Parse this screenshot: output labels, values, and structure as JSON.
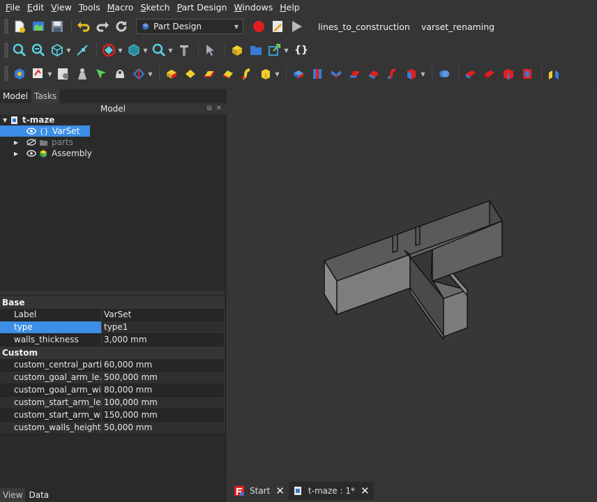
{
  "menu": [
    "File",
    "Edit",
    "View",
    "Tools",
    "Macro",
    "Sketch",
    "Part Design",
    "Windows",
    "Help"
  ],
  "menu_mnemonic": [
    "F",
    "E",
    "V",
    "T",
    "M",
    "S",
    "P",
    "W",
    "H"
  ],
  "workbench": {
    "selected": "Part Design"
  },
  "macros": [
    "lines_to_construction",
    "varset_renaming"
  ],
  "panel": {
    "tabs": [
      "Model",
      "Tasks"
    ],
    "header": "Model",
    "bottom_tabs": [
      "View",
      "Data"
    ]
  },
  "tree": {
    "root": "t-maze",
    "items": [
      {
        "label": "VarSet",
        "selected": true
      },
      {
        "label": "parts",
        "hidden": true
      },
      {
        "label": "Assembly"
      }
    ]
  },
  "properties": {
    "groups": [
      {
        "name": "Base",
        "rows": [
          {
            "name": "Label",
            "value": "VarSet"
          },
          {
            "name": "type",
            "value": "type1",
            "selected": true
          },
          {
            "name": "walls_thickness",
            "value": "3,000 mm"
          }
        ]
      },
      {
        "name": "Custom",
        "rows": [
          {
            "name": "custom_central_parti...",
            "value": "60,000 mm"
          },
          {
            "name": "custom_goal_arm_le...",
            "value": "500,000 mm"
          },
          {
            "name": "custom_goal_arm_wi...",
            "value": "80,000 mm"
          },
          {
            "name": "custom_start_arm_le...",
            "value": "100,000 mm"
          },
          {
            "name": "custom_start_arm_wi...",
            "value": "150,000 mm"
          },
          {
            "name": "custom_walls_height",
            "value": "50,000 mm"
          }
        ]
      }
    ]
  },
  "doc_tabs": [
    {
      "label": "Start"
    },
    {
      "label": "t-maze : 1*",
      "active": true
    }
  ],
  "colors": {
    "accent": "#3d8ee6",
    "record": "#e02020",
    "background": "#353535",
    "view_bg": "#373737"
  }
}
